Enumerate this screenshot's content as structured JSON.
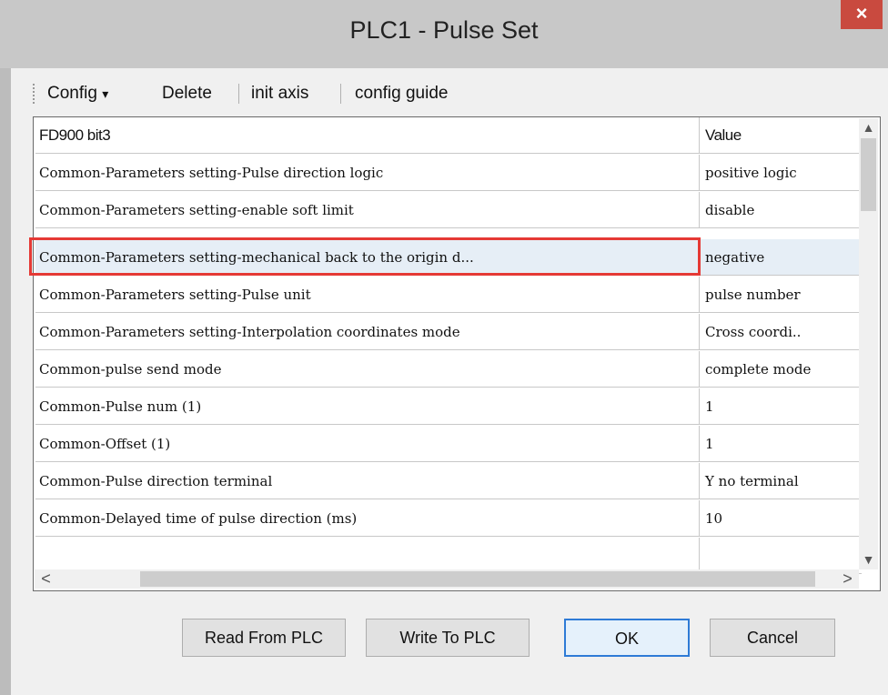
{
  "window": {
    "title": "PLC1 - Pulse  Set",
    "close_glyph": "×"
  },
  "toolbar": {
    "config_label": "Config",
    "config_arrow": "▾",
    "delete_label": "Delete",
    "init_axis_label": "init axis",
    "config_guide_label": "config guide"
  },
  "grid": {
    "header": {
      "name": "FD900 bit3",
      "value": "Value"
    },
    "rows": [
      {
        "name": "Common-Parameters setting-Pulse direction logic",
        "value": "positive logic"
      },
      {
        "name": "Common-Parameters setting-enable soft limit",
        "value": "disable"
      },
      {
        "name": "Common-Parameters setting-mechanical back to the origin d...",
        "value": "negative"
      },
      {
        "name": "Common-Parameters setting-Pulse unit",
        "value": "pulse number"
      },
      {
        "name": "Common-Parameters setting-Interpolation coordinates mode",
        "value": "Cross coordi.."
      },
      {
        "name": "Common-pulse send mode",
        "value": "complete mode"
      },
      {
        "name": "Common-Pulse num (1)",
        "value": "1"
      },
      {
        "name": "Common-Offset (1)",
        "value": "1"
      },
      {
        "name": "Common-Pulse direction terminal",
        "value": "Y no terminal"
      },
      {
        "name": "Common-Delayed time of pulse direction (ms)",
        "value": "10"
      }
    ],
    "selected_row": 2
  },
  "scroll": {
    "up": "▲",
    "down": "▼",
    "left": "<",
    "right": ">"
  },
  "buttons": {
    "read": "Read From PLC",
    "write": "Write To PLC",
    "ok": "OK",
    "cancel": "Cancel"
  }
}
